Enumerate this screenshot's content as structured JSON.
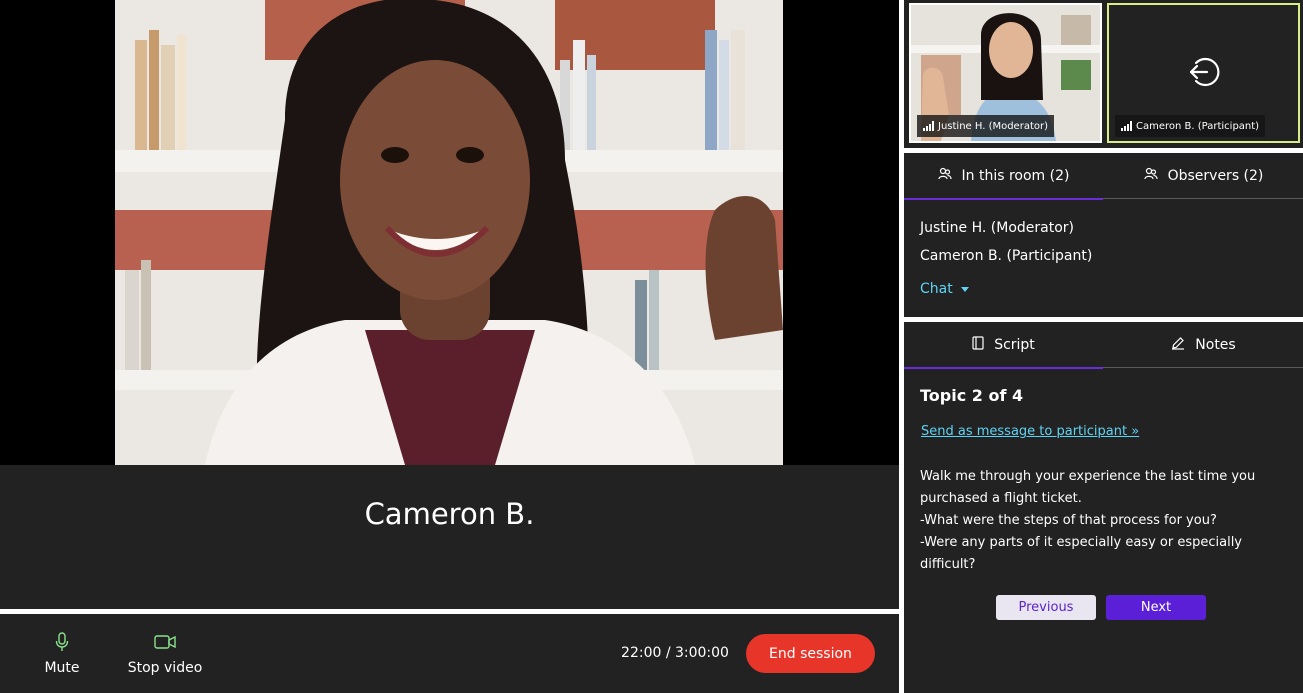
{
  "main": {
    "speaker_name": "Cameron B."
  },
  "controls": {
    "mute_label": "Mute",
    "stop_video_label": "Stop video",
    "timer": "22:00 / 3:00:00",
    "end_session_label": "End session"
  },
  "thumbnails": [
    {
      "label": "Justine H. (Moderator)"
    },
    {
      "label": "Cameron B. (Participant)"
    }
  ],
  "room": {
    "tabs": [
      {
        "label": "In this room (2)",
        "active": true
      },
      {
        "label": "Observers (2)",
        "active": false
      }
    ],
    "members": [
      "Justine H. (Moderator)",
      "Cameron B. (Participant)"
    ],
    "chat_label": "Chat"
  },
  "script": {
    "tabs": [
      {
        "label": "Script",
        "active": true
      },
      {
        "label": "Notes",
        "active": false
      }
    ],
    "topic": "Topic 2 of 4",
    "send_link": "Send as message to participant »",
    "lines": [
      "Walk me through your experience the last time you purchased a flight ticket.",
      "-What were the steps of that process for you?",
      "-Were any parts of it especially easy or especially difficult?"
    ],
    "previous_label": "Previous",
    "next_label": "Next"
  },
  "colors": {
    "panel": "#222222",
    "accent_purple": "#5a1fd6",
    "link_cyan": "#5fd3f3",
    "end_red": "#e8352a",
    "icon_green": "#8be28b",
    "active_thumb_border": "#d9ec8a"
  },
  "icons": {
    "mute": "microphone-icon",
    "stop_video": "video-camera-icon",
    "participant_thumb": "leave-arrow-icon",
    "people": "people-icon",
    "script": "document-icon",
    "notes": "pencil-icon",
    "signal": "signal-bars-icon"
  }
}
